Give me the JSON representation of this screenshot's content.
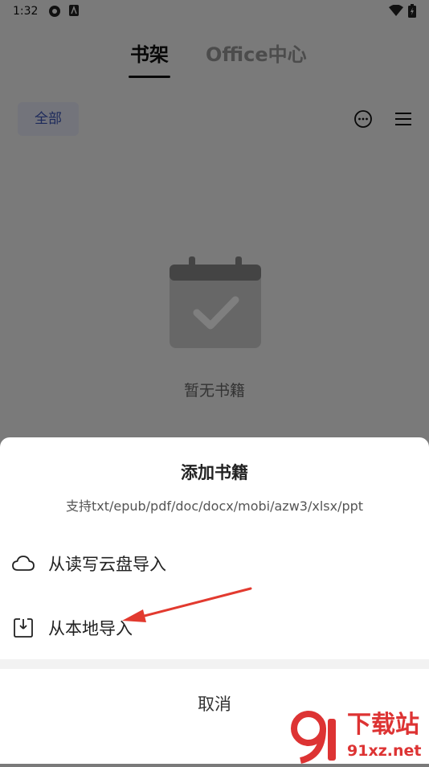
{
  "status_bar": {
    "time": "1:32"
  },
  "tabs": [
    {
      "label": "书架",
      "active": true
    },
    {
      "label": "Office中心",
      "active": false
    }
  ],
  "filter": {
    "label": "全部"
  },
  "empty_state": {
    "text": "暂无书籍"
  },
  "sheet": {
    "title": "添加书籍",
    "subtitle": "支持txt/epub/pdf/doc/docx/mobi/azw3/xlsx/ppt",
    "options": [
      {
        "label": "从读写云盘导入",
        "icon": "cloud-icon"
      },
      {
        "label": "从本地导入",
        "icon": "local-import-icon"
      }
    ],
    "cancel_label": "取消"
  },
  "watermark": {
    "title": "下载站",
    "url": "91xz.net"
  },
  "colors": {
    "accent": "#3b55b6",
    "arrow": "#e23a2f",
    "watermark": "#dd3333"
  }
}
